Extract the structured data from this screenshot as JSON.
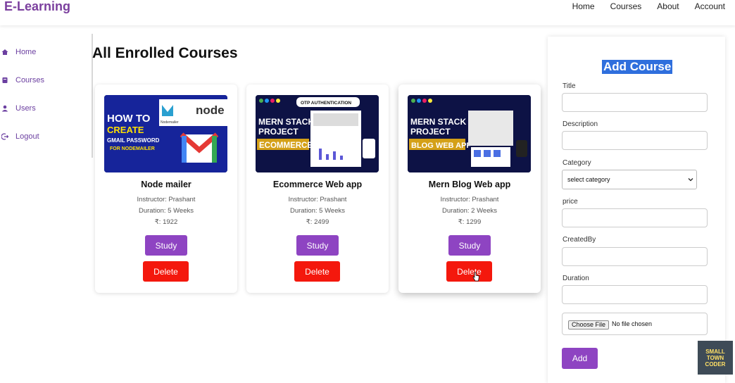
{
  "navbar": {
    "brand": "E-Learning",
    "links": [
      "Home",
      "Courses",
      "About",
      "Account"
    ]
  },
  "sidebar": {
    "items": [
      {
        "label": "Home",
        "icon": "home-icon"
      },
      {
        "label": "Courses",
        "icon": "book-icon"
      },
      {
        "label": "Users",
        "icon": "user-icon"
      },
      {
        "label": "Logout",
        "icon": "logout-icon"
      }
    ]
  },
  "main": {
    "title": "All Enrolled Courses",
    "courses": [
      {
        "title": "Node mailer",
        "instructor": "Instructor: Prashant",
        "duration": "Duration: 5 Weeks",
        "price": "₹: 1922",
        "study_label": "Study",
        "delete_label": "Delete",
        "thumb": {
          "line1": "HOW TO",
          "line2": "CREATE",
          "line3": "GMAIL PASSWORD",
          "line4": "FOR NODEMAILER",
          "brand": "node",
          "sub": "Nodemailer"
        }
      },
      {
        "title": "Ecommerce Web app",
        "instructor": "Instructor: Prashant",
        "duration": "Duration: 5 Weeks",
        "price": "₹: 2499",
        "study_label": "Study",
        "delete_label": "Delete",
        "thumb": {
          "badge": "OTP AUTHENTICATION",
          "line1": "MERN STACK",
          "line2": "PROJECT",
          "line3": "ECOMMERCE"
        }
      },
      {
        "title": "Mern Blog Web app",
        "instructor": "Instructor: Prashant",
        "duration": "Duration: 2 Weeks",
        "price": "₹: 1299",
        "study_label": "Study",
        "delete_label": "Delete",
        "thumb": {
          "line1": "MERN STACK",
          "line2": "PROJECT",
          "line3": "BLOG WEB APP"
        }
      }
    ]
  },
  "form": {
    "title": "Add Course",
    "fields": {
      "title_label": "Title",
      "description_label": "Description",
      "category_label": "Category",
      "category_selected": "select category",
      "price_label": "price",
      "createdby_label": "CreatedBy",
      "duration_label": "Duration",
      "file_button": "Choose File",
      "file_status": "No file chosen"
    },
    "submit_label": "Add"
  },
  "watermark": {
    "line1": "SMALL TOWN",
    "line2": "CODER"
  },
  "colors": {
    "brand": "#7b3f9e",
    "study": "#8e44c2",
    "delete": "#f4180d",
    "thumb_bg": "#0e1a52",
    "highlight": "#2f6fdd"
  }
}
